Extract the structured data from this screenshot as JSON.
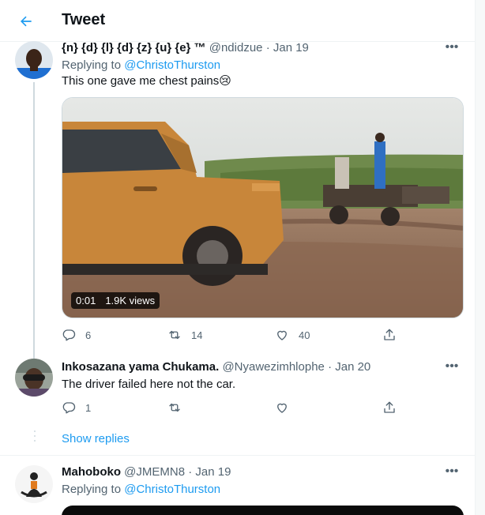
{
  "header": {
    "title": "Tweet"
  },
  "tweet1": {
    "name": "{n} {d} {l} {d} {z} {u} {e} ™",
    "handle": "@ndidzue",
    "sep": "·",
    "date": "Jan 19",
    "replying_prefix": "Replying to",
    "replying_to": "@ChristoThurston",
    "text": "This one gave me chest pains😢",
    "video_time": "0:01",
    "video_views": "1.9K views",
    "replies": "6",
    "retweets": "14",
    "likes": "40"
  },
  "tweet2": {
    "name": "Inkosazana yama Chukama.",
    "handle": "@Nyawezimhlophe",
    "sep": "·",
    "date": "Jan 20",
    "text": "The driver failed here not the car.",
    "replies": "1",
    "retweets": "",
    "likes": ""
  },
  "show_replies": "Show replies",
  "tweet3": {
    "name": "Mahoboko",
    "handle": "@JMEMN8",
    "sep": "·",
    "date": "Jan 19",
    "replying_prefix": "Replying to",
    "replying_to": "@ChristoThurston"
  },
  "more_glyph": "•••",
  "colors": {
    "accent": "#1d9bf0",
    "muted": "#536471",
    "truck": "#c8863a"
  }
}
